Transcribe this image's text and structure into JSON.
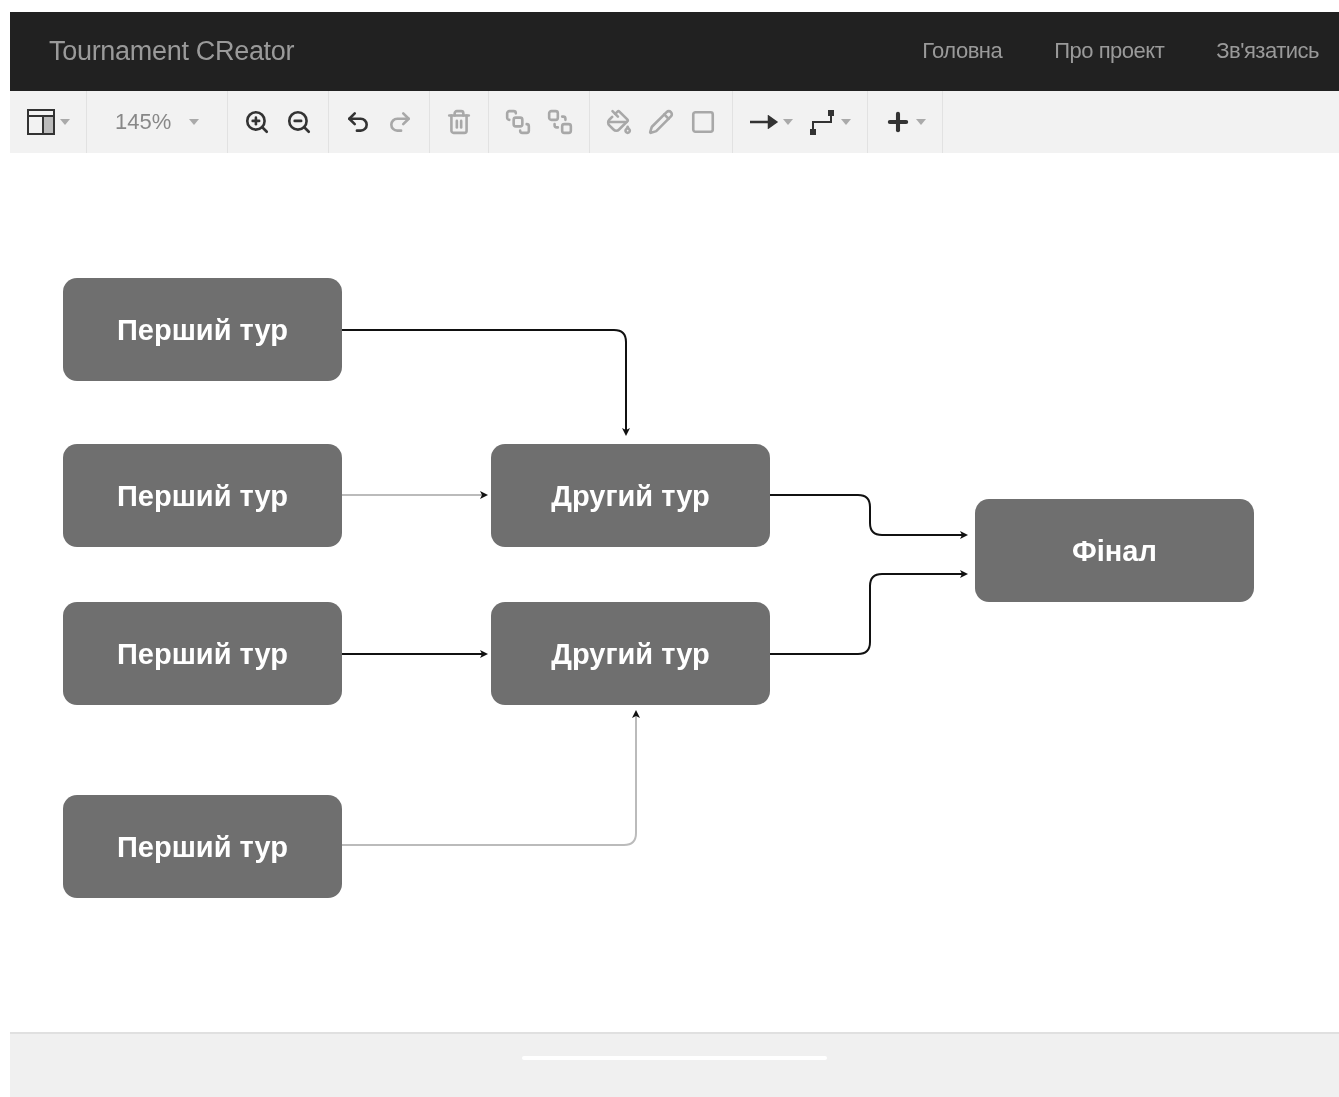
{
  "header": {
    "brand": "Tournament CReator",
    "nav": [
      "Головна",
      "Про проект",
      "Зв'язатись"
    ]
  },
  "toolbar": {
    "zoom": "145%",
    "tools": [
      {
        "disabled": false
      },
      {
        "disabled": false
      },
      {
        "disabled": false
      },
      {
        "disabled": false
      },
      {
        "disabled": true
      },
      {
        "disabled": true
      },
      {
        "disabled": true
      },
      {
        "disabled": true
      },
      {
        "disabled": true
      },
      {
        "disabled": true
      },
      {
        "disabled": true
      },
      {
        "disabled": false
      },
      {
        "disabled": false
      }
    ]
  },
  "diagram": {
    "first_round": [
      "Перший тур",
      "Перший тур",
      "Перший тур",
      "Перший тур"
    ],
    "second_round": [
      "Другий тур",
      "Другий тур"
    ],
    "final": "Фінал"
  }
}
